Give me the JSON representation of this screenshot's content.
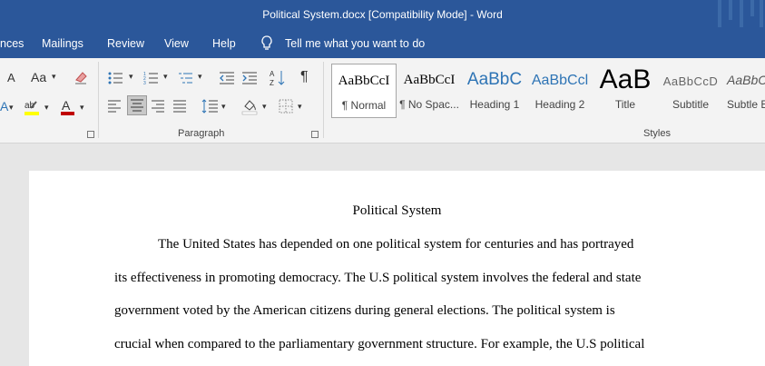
{
  "window": {
    "title": "Political System.docx [Compatibility Mode]  -  Word"
  },
  "menu": {
    "items": [
      "nces",
      "Mailings",
      "Review",
      "View",
      "Help"
    ],
    "tell_me": "Tell me what you want to do"
  },
  "ribbon": {
    "font_group": {
      "change_case": "Aa",
      "font_color_letter": "A",
      "font_size_letter": "A"
    },
    "paragraph_label": "Paragraph",
    "styles_label": "Styles",
    "styles": [
      {
        "sample": "AaBbCcI",
        "name": "¶ Normal"
      },
      {
        "sample": "AaBbCcI",
        "name": "¶ No Spac..."
      },
      {
        "sample": "AaBbC",
        "name": "Heading 1"
      },
      {
        "sample": "AaBbCcl",
        "name": "Heading 2"
      },
      {
        "sample": "AaB",
        "name": "Title"
      },
      {
        "sample": "AaBbCcD",
        "name": "Subtitle"
      },
      {
        "sample": "AaBbCcD",
        "name": "Subtle E"
      }
    ]
  },
  "document": {
    "title": "Political System",
    "lines": [
      "The United States has depended on one political system for centuries and has portrayed",
      "its effectiveness in promoting democracy. The U.S political system involves the federal and state",
      "government voted by the American citizens during general elections. The political system is",
      "crucial when compared to the parliamentary government structure. For example, the U.S political"
    ]
  },
  "colors": {
    "word_blue": "#2b579a",
    "heading_blue": "#2e74b5",
    "highlight": "#ffff00",
    "font_red": "#c00000"
  }
}
